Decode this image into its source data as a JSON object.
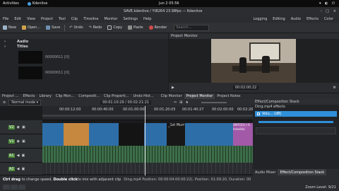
{
  "topbar": {
    "activities": "Activities",
    "app_name": "Kdenlive",
    "clock": "Jun 2  05:56"
  },
  "window": {
    "title": "SAVE.kdenlive / Yt8264 23.98fps — Kdenlive"
  },
  "menu": [
    "File",
    "Edit",
    "View",
    "Project",
    "Tool",
    "Clip",
    "Timeline",
    "Monitor",
    "Settings",
    "Help"
  ],
  "layouts": [
    "Logging",
    "Editing",
    "Audio",
    "Effects",
    "Color"
  ],
  "toolbar": {
    "new": "New",
    "open": "Open...",
    "save": "Save",
    "undo": "Undo",
    "redo": "Redo",
    "copy": "Copy",
    "paste": "Paste",
    "render": "Render",
    "search_placeholder": "Search..."
  },
  "bin": {
    "items": [
      "Audio",
      "Titles"
    ],
    "clip_names": [
      "00000011 [0]",
      "00000011 [0]"
    ]
  },
  "monitor": {
    "title": "Project Monitor",
    "timecode": "00:02:00:22"
  },
  "tabs": [
    "Project ...",
    "Effects",
    "Library",
    "Clip Mon...",
    "Compositi...",
    "Clip Properti...",
    "Undo Hist...",
    "Clip Monitor",
    "Project Monitor",
    "Project Notes"
  ],
  "timeline_tools": {
    "mode": "Normal mode",
    "position": "00:01:10:29 / 00:02:21:21"
  },
  "ruler_ticks": [
    "00:00:12:00",
    "00:00:40:00",
    "00:01:00:00",
    "00:01:20:05",
    "00:01:40:27",
    "00:02:00:00",
    "00:02:20:00"
  ],
  "tracks": [
    {
      "name": "V2"
    },
    {
      "name": "V1"
    },
    {
      "name": "A1"
    },
    {
      "name": "A2"
    }
  ],
  "clip_labels": {
    "v2_title": "_1st Murr",
    "v2_end": "ONTO[1] / 6 transitio"
  },
  "effects_panel": {
    "title": "Effect/Composition Stack",
    "clip": "Ding.mp4 effects",
    "effect": "Volu... (dB)"
  },
  "bottom_tabs": [
    "Audio Mixer",
    "Effect/Composition Stack"
  ],
  "status": {
    "hint_bold1": "Ctrl drag",
    "hint1": " to change speed, ",
    "hint_bold2": "Double click",
    "hint2": " to mix with adjacent clip",
    "info": "Ding.mp4  Position: 00:00:04:00:00:22), Position: 01:09:20, Duration: 00:00:17",
    "zoom": "Zoom Level: 9/21"
  },
  "colors": {
    "accent": "#2f8fd8",
    "video_clip": "#2e6ea8",
    "audio_clip": "#3e6e4a",
    "title_clip": "#c6873e",
    "effect_pink": "#a25aa8"
  }
}
